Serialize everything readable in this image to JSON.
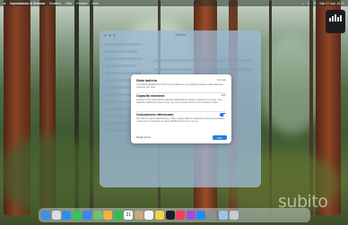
{
  "menubar": {
    "apple_icon": "apple-icon",
    "app_name": "Impostazioni di Sistema",
    "items": [
      "Modifica",
      "Vista",
      "Finestra",
      "Aiuto"
    ],
    "clock": "Sab 27 mar. 18:37"
  },
  "settings_window": {
    "title": "Batteria"
  },
  "dialog": {
    "battery_health": {
      "title": "Stato batteria",
      "value": "Normale",
      "description": "La batteria attualmente funziona normalmente e la capacità massima della batteria è coerente con l'età."
    },
    "max_capacity": {
      "title": "Capacità massima",
      "value": "89%",
      "description": "Questa è una misura della capacità della batteria rispetto a quando era nuova. Una capacità ridotta può determinare una minore autonomia tra una ricarica e l'altra."
    },
    "optimized_charging": {
      "title": "Caricamento ottimizzato",
      "enabled": true,
      "description": "Per ridurre l'usura della batteria, il Mac impara dalle tue abitudini di ricarica quotidiane e attende di completare la carica all'80% finché non ti serve."
    },
    "help_label": "Scopri di più...",
    "ok_label": "Fine"
  },
  "watermark": "subito",
  "dock": {
    "apps": [
      {
        "name": "finder-icon",
        "color": "#3d8fe8"
      },
      {
        "name": "launchpad-icon",
        "color": "#d9dde3"
      },
      {
        "name": "safari-icon",
        "color": "#2f8ff0"
      },
      {
        "name": "messages-icon",
        "color": "#34c759"
      },
      {
        "name": "mail-icon",
        "color": "#3a84f3"
      },
      {
        "name": "maps-icon",
        "color": "#6cc36a"
      },
      {
        "name": "photos-icon",
        "color": "#f2b23f"
      },
      {
        "name": "facetime-icon",
        "color": "#2fbf4f"
      },
      {
        "name": "calendar-icon",
        "color": "#ffffff"
      },
      {
        "name": "contacts-icon",
        "color": "#c9a77a"
      },
      {
        "name": "reminders-icon",
        "color": "#f4f4f4"
      },
      {
        "name": "notes-icon",
        "color": "#f7d34a"
      },
      {
        "name": "tv-icon",
        "color": "#1d1d1f"
      },
      {
        "name": "music-icon",
        "color": "#fa3c5a"
      },
      {
        "name": "podcasts-icon",
        "color": "#a24be0"
      },
      {
        "name": "app-store-icon",
        "color": "#1e8ef5"
      },
      {
        "name": "system-settings-icon",
        "color": "#8e8e93"
      },
      {
        "name": "preview-icon",
        "color": "#9cc3ea"
      },
      {
        "name": "trash-icon",
        "color": "#c7ccd3"
      }
    ],
    "calendar_day": "21"
  }
}
